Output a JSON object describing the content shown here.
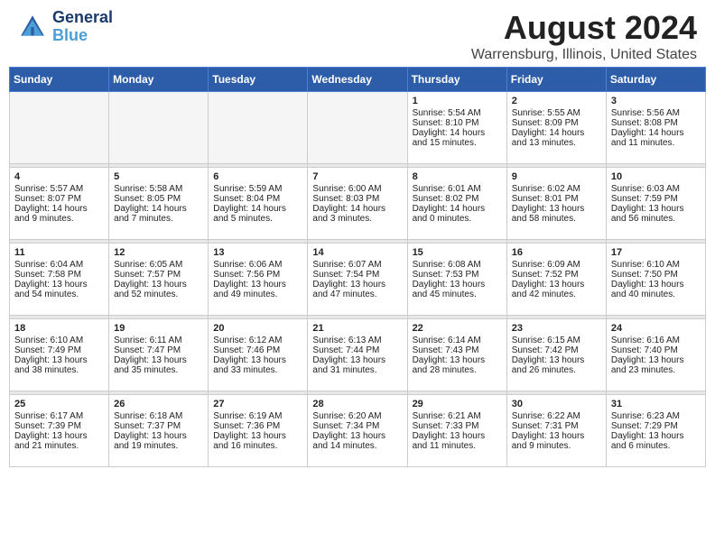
{
  "header": {
    "logo_line1": "General",
    "logo_line2": "Blue",
    "title": "August 2024",
    "subtitle": "Warrensburg, Illinois, United States"
  },
  "weekdays": [
    "Sunday",
    "Monday",
    "Tuesday",
    "Wednesday",
    "Thursday",
    "Friday",
    "Saturday"
  ],
  "weeks": [
    [
      {
        "day": "",
        "content": ""
      },
      {
        "day": "",
        "content": ""
      },
      {
        "day": "",
        "content": ""
      },
      {
        "day": "",
        "content": ""
      },
      {
        "day": "1",
        "content": "Sunrise: 5:54 AM\nSunset: 8:10 PM\nDaylight: 14 hours\nand 15 minutes."
      },
      {
        "day": "2",
        "content": "Sunrise: 5:55 AM\nSunset: 8:09 PM\nDaylight: 14 hours\nand 13 minutes."
      },
      {
        "day": "3",
        "content": "Sunrise: 5:56 AM\nSunset: 8:08 PM\nDaylight: 14 hours\nand 11 minutes."
      }
    ],
    [
      {
        "day": "4",
        "content": "Sunrise: 5:57 AM\nSunset: 8:07 PM\nDaylight: 14 hours\nand 9 minutes."
      },
      {
        "day": "5",
        "content": "Sunrise: 5:58 AM\nSunset: 8:05 PM\nDaylight: 14 hours\nand 7 minutes."
      },
      {
        "day": "6",
        "content": "Sunrise: 5:59 AM\nSunset: 8:04 PM\nDaylight: 14 hours\nand 5 minutes."
      },
      {
        "day": "7",
        "content": "Sunrise: 6:00 AM\nSunset: 8:03 PM\nDaylight: 14 hours\nand 3 minutes."
      },
      {
        "day": "8",
        "content": "Sunrise: 6:01 AM\nSunset: 8:02 PM\nDaylight: 14 hours\nand 0 minutes."
      },
      {
        "day": "9",
        "content": "Sunrise: 6:02 AM\nSunset: 8:01 PM\nDaylight: 13 hours\nand 58 minutes."
      },
      {
        "day": "10",
        "content": "Sunrise: 6:03 AM\nSunset: 7:59 PM\nDaylight: 13 hours\nand 56 minutes."
      }
    ],
    [
      {
        "day": "11",
        "content": "Sunrise: 6:04 AM\nSunset: 7:58 PM\nDaylight: 13 hours\nand 54 minutes."
      },
      {
        "day": "12",
        "content": "Sunrise: 6:05 AM\nSunset: 7:57 PM\nDaylight: 13 hours\nand 52 minutes."
      },
      {
        "day": "13",
        "content": "Sunrise: 6:06 AM\nSunset: 7:56 PM\nDaylight: 13 hours\nand 49 minutes."
      },
      {
        "day": "14",
        "content": "Sunrise: 6:07 AM\nSunset: 7:54 PM\nDaylight: 13 hours\nand 47 minutes."
      },
      {
        "day": "15",
        "content": "Sunrise: 6:08 AM\nSunset: 7:53 PM\nDaylight: 13 hours\nand 45 minutes."
      },
      {
        "day": "16",
        "content": "Sunrise: 6:09 AM\nSunset: 7:52 PM\nDaylight: 13 hours\nand 42 minutes."
      },
      {
        "day": "17",
        "content": "Sunrise: 6:10 AM\nSunset: 7:50 PM\nDaylight: 13 hours\nand 40 minutes."
      }
    ],
    [
      {
        "day": "18",
        "content": "Sunrise: 6:10 AM\nSunset: 7:49 PM\nDaylight: 13 hours\nand 38 minutes."
      },
      {
        "day": "19",
        "content": "Sunrise: 6:11 AM\nSunset: 7:47 PM\nDaylight: 13 hours\nand 35 minutes."
      },
      {
        "day": "20",
        "content": "Sunrise: 6:12 AM\nSunset: 7:46 PM\nDaylight: 13 hours\nand 33 minutes."
      },
      {
        "day": "21",
        "content": "Sunrise: 6:13 AM\nSunset: 7:44 PM\nDaylight: 13 hours\nand 31 minutes."
      },
      {
        "day": "22",
        "content": "Sunrise: 6:14 AM\nSunset: 7:43 PM\nDaylight: 13 hours\nand 28 minutes."
      },
      {
        "day": "23",
        "content": "Sunrise: 6:15 AM\nSunset: 7:42 PM\nDaylight: 13 hours\nand 26 minutes."
      },
      {
        "day": "24",
        "content": "Sunrise: 6:16 AM\nSunset: 7:40 PM\nDaylight: 13 hours\nand 23 minutes."
      }
    ],
    [
      {
        "day": "25",
        "content": "Sunrise: 6:17 AM\nSunset: 7:39 PM\nDaylight: 13 hours\nand 21 minutes."
      },
      {
        "day": "26",
        "content": "Sunrise: 6:18 AM\nSunset: 7:37 PM\nDaylight: 13 hours\nand 19 minutes."
      },
      {
        "day": "27",
        "content": "Sunrise: 6:19 AM\nSunset: 7:36 PM\nDaylight: 13 hours\nand 16 minutes."
      },
      {
        "day": "28",
        "content": "Sunrise: 6:20 AM\nSunset: 7:34 PM\nDaylight: 13 hours\nand 14 minutes."
      },
      {
        "day": "29",
        "content": "Sunrise: 6:21 AM\nSunset: 7:33 PM\nDaylight: 13 hours\nand 11 minutes."
      },
      {
        "day": "30",
        "content": "Sunrise: 6:22 AM\nSunset: 7:31 PM\nDaylight: 13 hours\nand 9 minutes."
      },
      {
        "day": "31",
        "content": "Sunrise: 6:23 AM\nSunset: 7:29 PM\nDaylight: 13 hours\nand 6 minutes."
      }
    ]
  ]
}
